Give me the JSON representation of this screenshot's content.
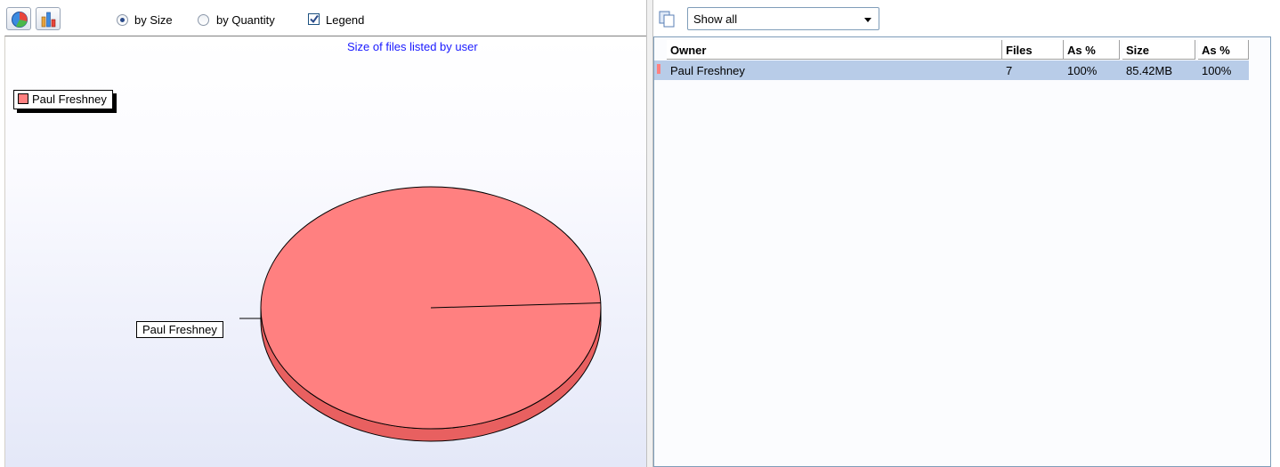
{
  "toolbar": {
    "pie_button_icon": "pie-chart-icon",
    "bar_button_icon": "bar-chart-icon",
    "option_size": "by Size",
    "option_quantity": "by Quantity",
    "selected_option": "by Size",
    "legend_label": "Legend",
    "legend_checked": true
  },
  "chart_data": {
    "type": "pie",
    "title": "Size of files listed by user",
    "categories": [
      "Paul Freshney"
    ],
    "values": [
      100
    ],
    "legend": [
      "Paul Freshney"
    ],
    "legend_placement": "top-left",
    "slice_labels": [
      "Paul Freshney"
    ],
    "colors": [
      "#ff8080"
    ]
  },
  "filter": {
    "icon": "copy-icon",
    "selected": "Show all"
  },
  "table": {
    "columns": [
      "Owner",
      "Files",
      "As %",
      "Size",
      "As %"
    ],
    "rows": [
      {
        "owner": "Paul Freshney",
        "files": "7",
        "files_pct": "100%",
        "size": "85.42MB",
        "size_pct": "100%",
        "color": "#ff8080"
      }
    ]
  },
  "colors": {
    "slice": "#ff8080",
    "slice_side": "#e86060",
    "chart_title": "#1a1aff",
    "selected_row": "#b8cce8"
  }
}
